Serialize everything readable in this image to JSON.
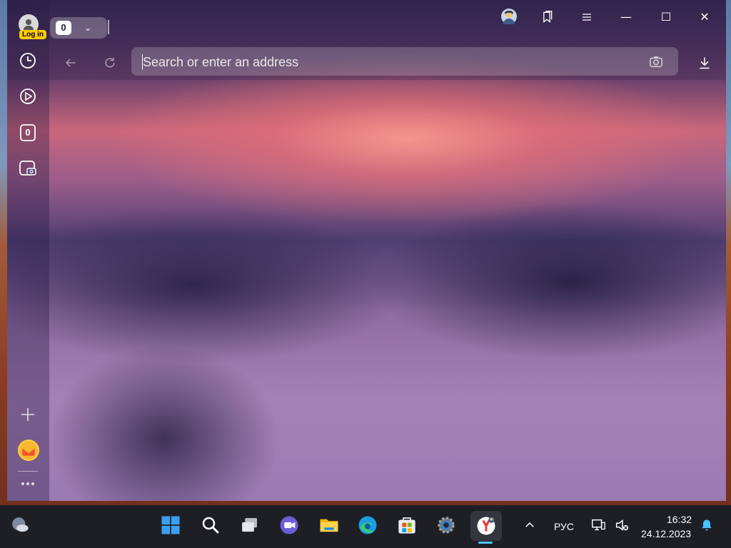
{
  "browser": {
    "login_label": "Log in",
    "tab_count": "0",
    "address_placeholder": "Search or enter an address",
    "sidebar_counter": "0"
  },
  "taskbar": {
    "language": "РУС",
    "time": "16:32",
    "date": "24.12.2023"
  },
  "colors": {
    "accent": "#4cc2ff",
    "login_badge": "#ffcc00"
  },
  "icons": [
    "profile-icon",
    "tab-dropdown-chevron-icon",
    "profile-avatar-icon",
    "bookmarks-icon",
    "menu-icon",
    "minimize-icon",
    "maximize-icon",
    "close-icon",
    "back-icon",
    "reload-icon",
    "camera-search-icon",
    "downloads-icon",
    "history-icon",
    "play-icon",
    "counter-icon",
    "screenshot-icon",
    "add-icon",
    "mail-icon",
    "more-icon",
    "weather-icon",
    "start-icon",
    "search-icon",
    "task-view-icon",
    "chat-icon",
    "file-explorer-icon",
    "edge-icon",
    "store-icon",
    "settings-icon",
    "yandex-browser-icon",
    "show-hidden-icons-chevron",
    "network-icon",
    "volume-muted-icon",
    "notifications-icon"
  ]
}
